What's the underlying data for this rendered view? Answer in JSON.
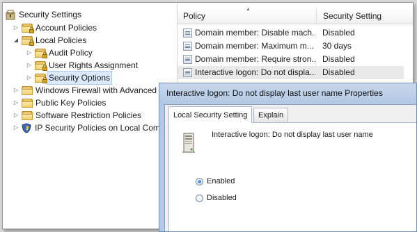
{
  "tree": {
    "root": {
      "label": "Security Settings"
    },
    "items": [
      {
        "label": "Account Policies",
        "twisty": "collapsed",
        "icon": "locked-folder-icon"
      },
      {
        "label": "Local Policies",
        "twisty": "expanded",
        "icon": "locked-folder-icon"
      },
      {
        "label": "Audit Policy",
        "twisty": "collapsed",
        "icon": "locked-folder-icon"
      },
      {
        "label": "User Rights Assignment",
        "twisty": "collapsed",
        "icon": "locked-folder-icon"
      },
      {
        "label": "Security Options",
        "twisty": "collapsed",
        "icon": "locked-folder-icon",
        "selected": true
      },
      {
        "label": "Windows Firewall with Advanced",
        "twisty": "collapsed",
        "icon": "folder-icon"
      },
      {
        "label": "Public Key Policies",
        "twisty": "collapsed",
        "icon": "folder-icon"
      },
      {
        "label": "Software Restriction Policies",
        "twisty": "collapsed",
        "icon": "folder-icon"
      },
      {
        "label": "IP Security Policies on Local Com",
        "twisty": "collapsed",
        "icon": "shield-icon"
      }
    ]
  },
  "list": {
    "columns": {
      "policy": "Policy",
      "setting": "Security Setting"
    },
    "rows": [
      {
        "policy": "Domain member: Disable mach...",
        "setting": "Disabled"
      },
      {
        "policy": "Domain member: Maximum m...",
        "setting": "30 days"
      },
      {
        "policy": "Domain member: Require stron...",
        "setting": "Disabled"
      },
      {
        "policy": "Interactive logon: Do not displa...",
        "setting": "Disabled",
        "highlighted": true
      }
    ]
  },
  "dialog": {
    "title": "Interactive logon: Do not display last user name Properties",
    "tabs": [
      {
        "label": "Local Security Setting",
        "active": true
      },
      {
        "label": "Explain",
        "active": false
      }
    ],
    "policy_name": "Interactive logon: Do not display last user name",
    "options": [
      {
        "label": "Enabled",
        "checked": true
      },
      {
        "label": "Disabled",
        "checked": false
      }
    ]
  },
  "colors": {
    "selection": "#dbeafb",
    "dialog_frame": "#b3c8e4",
    "folder": "#f1cf6c"
  }
}
